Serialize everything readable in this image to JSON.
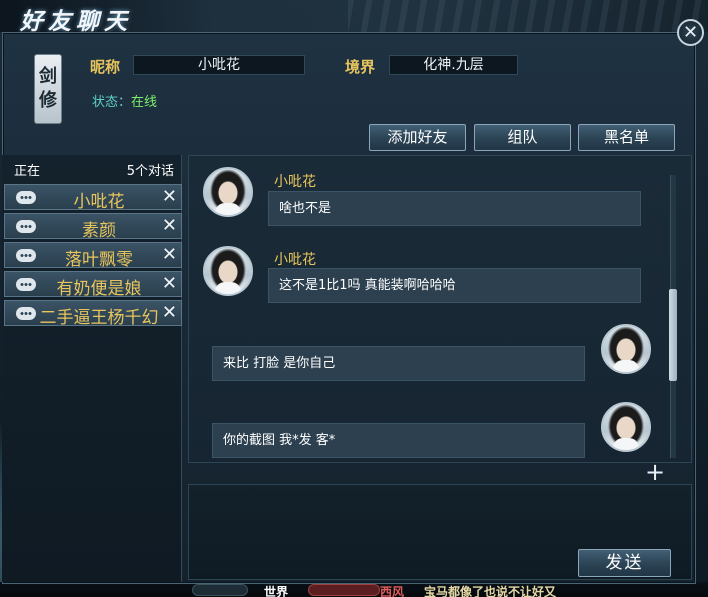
{
  "window": {
    "title": "好友聊天"
  },
  "profile": {
    "class_badge": [
      "剑",
      "修"
    ],
    "nickname_label": "昵称",
    "nickname": "小吡花",
    "realm_label": "境界",
    "realm": "化神.九层",
    "status_label": "状态：",
    "status_value": "在线"
  },
  "actions": {
    "add_friend": "添加好友",
    "team": "组队",
    "blacklist": "黑名单"
  },
  "conversations": {
    "header_left": "正在",
    "header_right": "5个对话",
    "items": [
      {
        "name": "小吡花",
        "close": "✕"
      },
      {
        "name": "素颜",
        "close": "✕"
      },
      {
        "name": "落叶飘零",
        "close": "✕"
      },
      {
        "name": "有奶便是娘",
        "close": "✕"
      },
      {
        "name": "二手逼王杨千幻",
        "close": "✕"
      }
    ]
  },
  "messages": [
    {
      "side": "left",
      "sender": "小吡花",
      "text": "啥也不是"
    },
    {
      "side": "left",
      "sender": "小吡花",
      "text": "这不是1比1吗 真能装啊哈哈哈"
    },
    {
      "side": "right",
      "sender": "",
      "text": "来比 打脸 是你自己"
    },
    {
      "side": "right",
      "sender": "",
      "text": "你的截图 我*发 客*"
    }
  ],
  "composer": {
    "plus_label": "+",
    "send_label": "发送"
  },
  "bottom_bar": {
    "world": "世界",
    "faction": "西风",
    "ticker": "宝马都像了也说不让好又"
  },
  "icons": {
    "close": "close-icon",
    "bubble": "chat-bubble-icon",
    "plus": "plus-icon"
  }
}
